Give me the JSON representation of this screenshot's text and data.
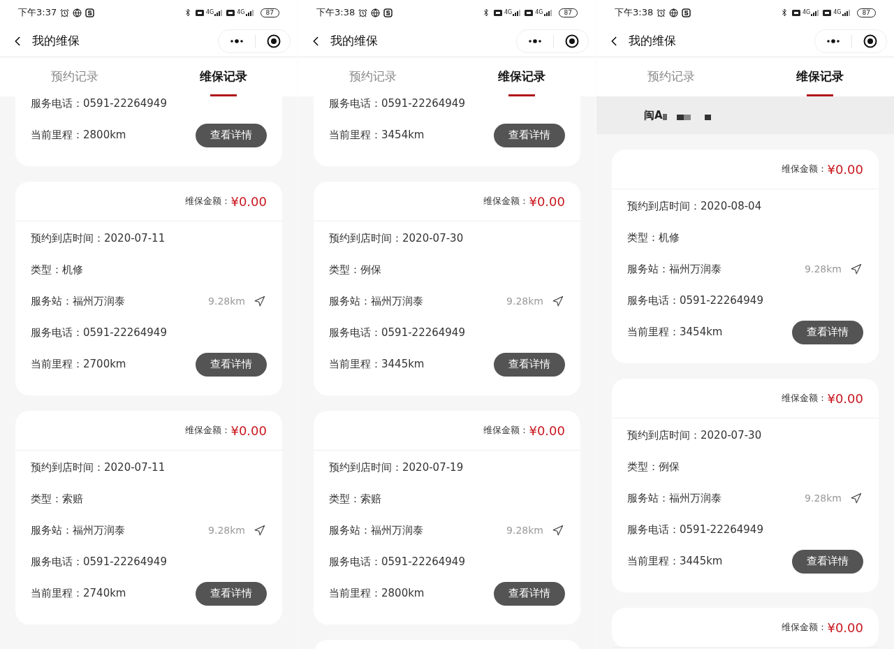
{
  "screens": [
    {
      "status_bar": {
        "time": "下午3:37",
        "signals": [
          "4G",
          "4G"
        ],
        "battery": "87"
      },
      "nav": {
        "title": "我的维保"
      },
      "tabs": [
        {
          "label": "预约记录",
          "selected": false
        },
        {
          "label": "维保记录",
          "selected": true
        }
      ],
      "cards": [
        {
          "cut_top": true,
          "fields": [
            {
              "kind": "text",
              "text": "服务电话：0591-22264949"
            },
            {
              "kind": "mileage",
              "text": "当前里程：2800km",
              "button": "查看详情"
            }
          ]
        },
        {
          "amount": {
            "label": "维保金额：",
            "value": "¥0.00"
          },
          "fields": [
            {
              "kind": "text",
              "text": "预约到店时间：2020-07-11"
            },
            {
              "kind": "text",
              "text": "类型：机修"
            },
            {
              "kind": "station",
              "text": "服务站：福州万润泰",
              "distance": "9.28km"
            },
            {
              "kind": "text",
              "text": "服务电话：0591-22264949"
            },
            {
              "kind": "mileage",
              "text": "当前里程：2700km",
              "button": "查看详情"
            }
          ]
        },
        {
          "amount": {
            "label": "维保金额：",
            "value": "¥0.00"
          },
          "fields": [
            {
              "kind": "text",
              "text": "预约到店时间：2020-07-11"
            },
            {
              "kind": "text",
              "text": "类型：索赔"
            },
            {
              "kind": "station",
              "text": "服务站：福州万润泰",
              "distance": "9.28km"
            },
            {
              "kind": "text",
              "text": "服务电话：0591-22264949"
            },
            {
              "kind": "mileage",
              "text": "当前里程：2740km",
              "button": "查看详情"
            }
          ]
        }
      ],
      "more_below": false
    },
    {
      "status_bar": {
        "time": "下午3:38",
        "signals": [
          "4G",
          "4G"
        ],
        "battery": "87"
      },
      "nav": {
        "title": "我的维保"
      },
      "tabs": [
        {
          "label": "预约记录",
          "selected": false
        },
        {
          "label": "维保记录",
          "selected": true
        }
      ],
      "cards": [
        {
          "cut_top": true,
          "fields": [
            {
              "kind": "text",
              "text": "服务电话：0591-22264949"
            },
            {
              "kind": "mileage",
              "text": "当前里程：3454km",
              "button": "查看详情"
            }
          ]
        },
        {
          "amount": {
            "label": "维保金额：",
            "value": "¥0.00"
          },
          "fields": [
            {
              "kind": "text",
              "text": "预约到店时间：2020-07-30"
            },
            {
              "kind": "text",
              "text": "类型：例保"
            },
            {
              "kind": "station",
              "text": "服务站：福州万润泰",
              "distance": "9.28km"
            },
            {
              "kind": "text",
              "text": "服务电话：0591-22264949"
            },
            {
              "kind": "mileage",
              "text": "当前里程：3445km",
              "button": "查看详情"
            }
          ]
        },
        {
          "amount": {
            "label": "维保金额：",
            "value": "¥0.00"
          },
          "fields": [
            {
              "kind": "text",
              "text": "预约到店时间：2020-07-19"
            },
            {
              "kind": "text",
              "text": "类型：索赔"
            },
            {
              "kind": "station",
              "text": "服务站：福州万润泰",
              "distance": "9.28km"
            },
            {
              "kind": "text",
              "text": "服务电话：0591-22264949"
            },
            {
              "kind": "mileage",
              "text": "当前里程：2800km",
              "button": "查看详情"
            }
          ]
        }
      ],
      "more_below": true
    },
    {
      "status_bar": {
        "time": "下午3:38",
        "signals": [
          "4G",
          "4G"
        ],
        "battery": "87"
      },
      "nav": {
        "title": "我的维保"
      },
      "tabs": [
        {
          "label": "预约记录",
          "selected": false
        },
        {
          "label": "维保记录",
          "selected": true
        }
      ],
      "plate": "闽A",
      "cards": [
        {
          "amount": {
            "label": "维保金额：",
            "value": "¥0.00"
          },
          "fields": [
            {
              "kind": "text",
              "text": "预约到店时间：2020-08-04"
            },
            {
              "kind": "text",
              "text": "类型：机修"
            },
            {
              "kind": "station",
              "text": "服务站：福州万润泰",
              "distance": "9.28km"
            },
            {
              "kind": "text",
              "text": "服务电话：0591-22264949"
            },
            {
              "kind": "mileage",
              "text": "当前里程：3454km",
              "button": "查看详情"
            }
          ]
        },
        {
          "amount": {
            "label": "维保金额：",
            "value": "¥0.00"
          },
          "fields": [
            {
              "kind": "text",
              "text": "预约到店时间：2020-07-30"
            },
            {
              "kind": "text",
              "text": "类型：例保"
            },
            {
              "kind": "station",
              "text": "服务站：福州万润泰",
              "distance": "9.28km"
            },
            {
              "kind": "text",
              "text": "服务电话：0591-22264949"
            },
            {
              "kind": "mileage",
              "text": "当前里程：3445km",
              "button": "查看详情"
            }
          ]
        },
        {
          "amount": {
            "label": "维保金额：",
            "value": "¥0.00"
          }
        }
      ],
      "more_below": false
    }
  ]
}
